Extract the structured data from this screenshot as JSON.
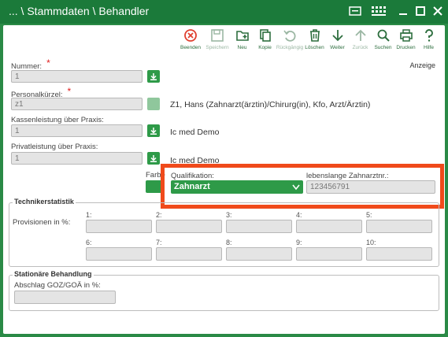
{
  "window": {
    "title": "... \\ Stammdaten \\ Behandler"
  },
  "toolbar": {
    "buttons": [
      {
        "label": "Beenden",
        "icon": "close-circle-icon"
      },
      {
        "label": "Speichern",
        "icon": "save-icon"
      },
      {
        "label": "Neu",
        "icon": "new-folder-icon"
      },
      {
        "label": "Kopie",
        "icon": "copy-icon"
      },
      {
        "label": "Rückgängig",
        "icon": "undo-icon"
      },
      {
        "label": "Löschen",
        "icon": "trash-icon"
      },
      {
        "label": "Weiter",
        "icon": "arrow-down-icon"
      },
      {
        "label": "Zurück",
        "icon": "arrow-up-icon"
      },
      {
        "label": "Suchen",
        "icon": "search-icon"
      },
      {
        "label": "Drucken",
        "icon": "printer-icon"
      },
      {
        "label": "Hilfe",
        "icon": "help-icon"
      }
    ]
  },
  "anzeige": "Anzeige",
  "form": {
    "nummer_label": "Nummer:",
    "nummer_value": "1",
    "personalkuerzel_label": "Personalkürzel:",
    "personalkuerzel_value": "z1",
    "personal_info": "Z1, Hans (Zahnarzt(ärztin)/Chirurg(in), Kfo, Arzt/Ärztin)",
    "kassenleistung_label": "Kassenleistung über Praxis:",
    "kassenleistung_value": "1",
    "kassen_info": "Ic med Demo",
    "privatleistung_label": "Privatleistung über Praxis:",
    "privatleistung_value": "1",
    "privat_info": "Ic med Demo",
    "farbe_label": "Farbe",
    "required_mark": "*",
    "qualifikation_label": "Qualifikation:",
    "qualifikation_value": "Zahnarzt",
    "zahnarztnr_label": "lebenslange Zahnarztnr.:",
    "zahnarztnr_value": "123456791"
  },
  "technikerstatistik": {
    "title": "Technikerstatistik",
    "provisionen_label": "Provisionen in %:",
    "slots_row1": [
      "1:",
      "2:",
      "3:",
      "4:",
      "5:"
    ],
    "slots_row2": [
      "6:",
      "7:",
      "8:",
      "9:",
      "10:"
    ]
  },
  "stationaer": {
    "title": "Stationäre Behandlung",
    "abschlag_label": "Abschlag GOZ/GOÄ in %:"
  },
  "colors": {
    "accent": "#2e9a48",
    "frame": "#1b7a3a",
    "highlight": "#f04a1b"
  }
}
